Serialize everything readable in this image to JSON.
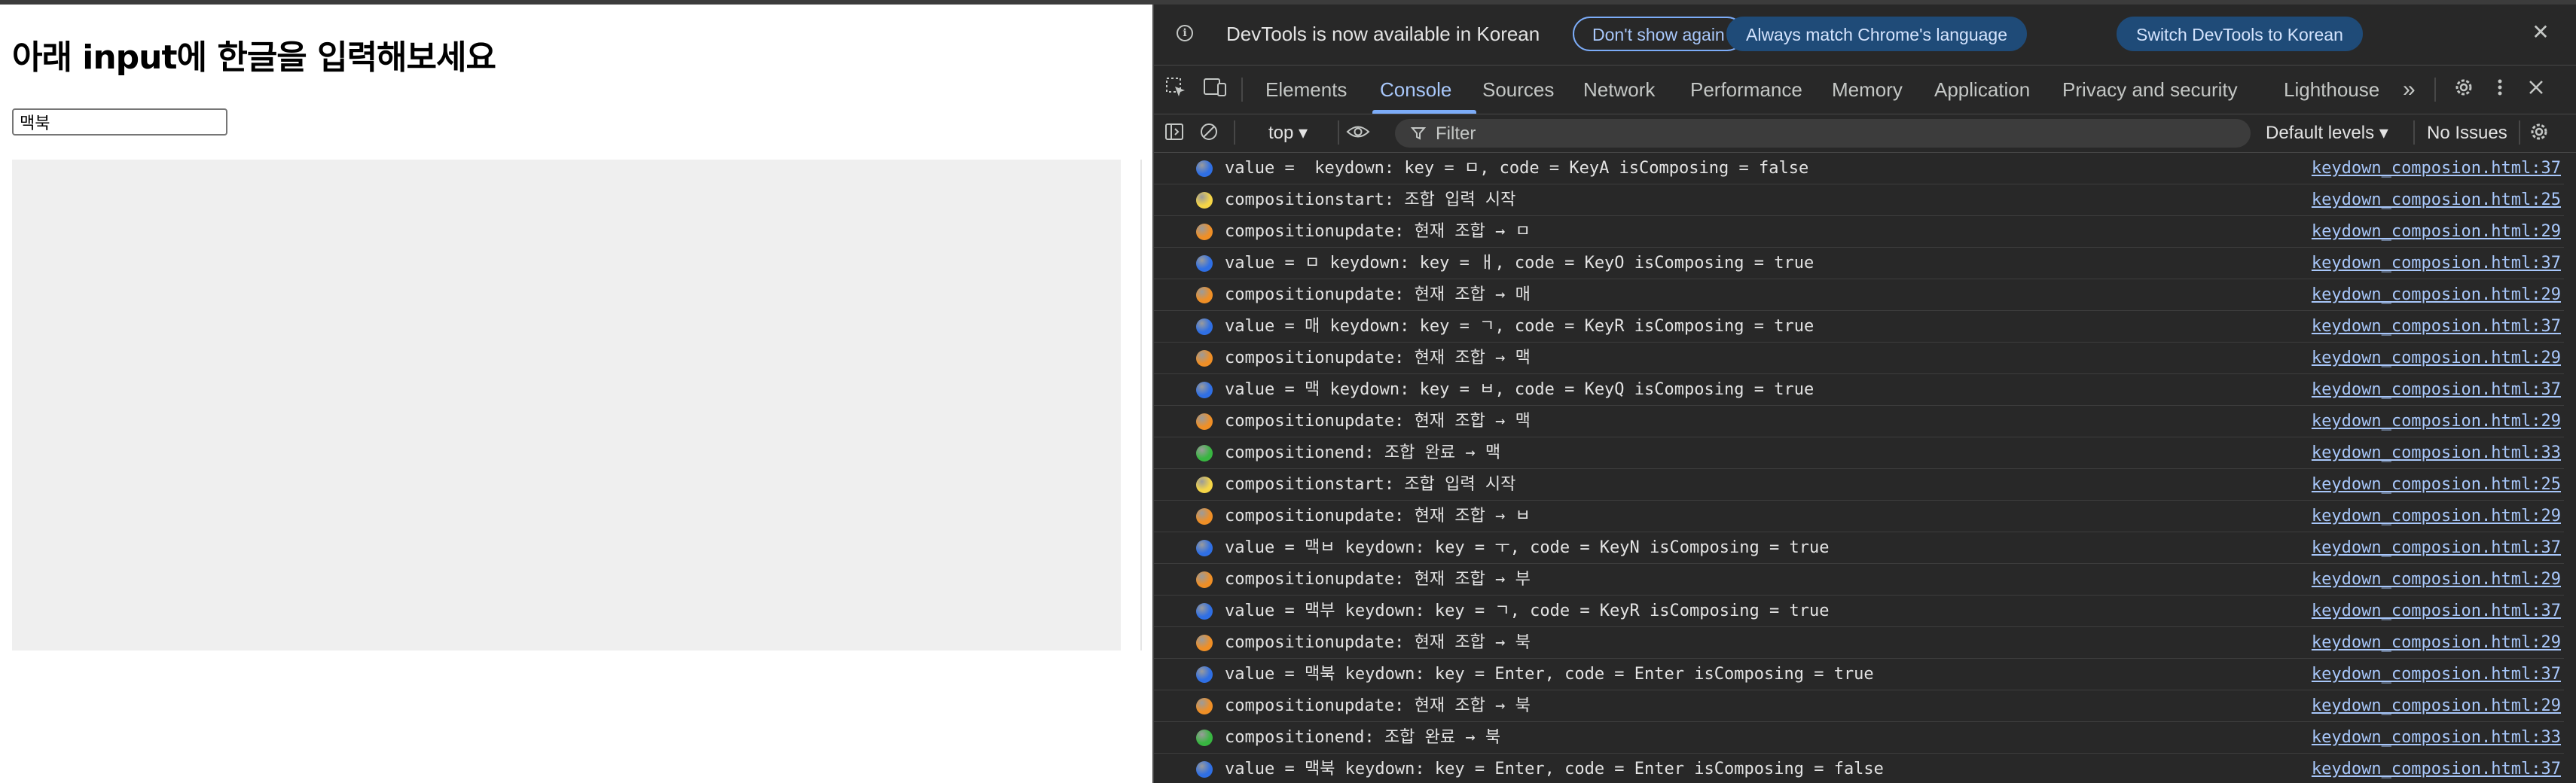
{
  "page": {
    "heading": "아래 input에 한글을 입력해보세요",
    "input_value": "맥북"
  },
  "devtools": {
    "infobar": {
      "message": "DevTools is now available in Korean",
      "dont_show": "Don't show again",
      "always_match": "Always match Chrome's language",
      "switch": "Switch DevTools to Korean",
      "close": "✕"
    },
    "tabs": {
      "elements": "Elements",
      "console": "Console",
      "sources": "Sources",
      "network": "Network",
      "performance": "Performance",
      "memory": "Memory",
      "application": "Application",
      "privacy": "Privacy and security",
      "lighthouse": "Lighthouse",
      "more": "»"
    },
    "toolbar": {
      "context": "top ▾",
      "filter_placeholder": "Filter",
      "levels": "Default levels ▾",
      "issues": "No Issues"
    },
    "colors": {
      "blue": "#2f6fe4",
      "yellow": "#f5d547",
      "orange": "#ef8f26",
      "green": "#38b641"
    },
    "logs": [
      {
        "color": "blue",
        "text": "value =  keydown: key = ㅁ, code = KeyA isComposing = false",
        "src": "keydown_composion.html:37"
      },
      {
        "color": "yellow",
        "text": "compositionstart: 조합 입력 시작",
        "src": "keydown_composion.html:25"
      },
      {
        "color": "orange",
        "text": "compositionupdate: 현재 조합 → ㅁ",
        "src": "keydown_composion.html:29"
      },
      {
        "color": "blue",
        "text": "value = ㅁ keydown: key = ㅐ, code = KeyO isComposing = true",
        "src": "keydown_composion.html:37"
      },
      {
        "color": "orange",
        "text": "compositionupdate: 현재 조합 → 매",
        "src": "keydown_composion.html:29"
      },
      {
        "color": "blue",
        "text": "value = 매 keydown: key = ㄱ, code = KeyR isComposing = true",
        "src": "keydown_composion.html:37"
      },
      {
        "color": "orange",
        "text": "compositionupdate: 현재 조합 → 맥",
        "src": "keydown_composion.html:29"
      },
      {
        "color": "blue",
        "text": "value = 맥 keydown: key = ㅂ, code = KeyQ isComposing = true",
        "src": "keydown_composion.html:37"
      },
      {
        "color": "orange",
        "text": "compositionupdate: 현재 조합 → 맥",
        "src": "keydown_composion.html:29"
      },
      {
        "color": "green",
        "text": "compositionend: 조합 완료 → 맥",
        "src": "keydown_composion.html:33"
      },
      {
        "color": "yellow",
        "text": "compositionstart: 조합 입력 시작",
        "src": "keydown_composion.html:25"
      },
      {
        "color": "orange",
        "text": "compositionupdate: 현재 조합 → ㅂ",
        "src": "keydown_composion.html:29"
      },
      {
        "color": "blue",
        "text": "value = 맥ㅂ keydown: key = ㅜ, code = KeyN isComposing = true",
        "src": "keydown_composion.html:37"
      },
      {
        "color": "orange",
        "text": "compositionupdate: 현재 조합 → 부",
        "src": "keydown_composion.html:29"
      },
      {
        "color": "blue",
        "text": "value = 맥부 keydown: key = ㄱ, code = KeyR isComposing = true",
        "src": "keydown_composion.html:37"
      },
      {
        "color": "orange",
        "text": "compositionupdate: 현재 조합 → 북",
        "src": "keydown_composion.html:29"
      },
      {
        "color": "blue",
        "text": "value = 맥북 keydown: key = Enter, code = Enter isComposing = true",
        "src": "keydown_composion.html:37"
      },
      {
        "color": "orange",
        "text": "compositionupdate: 현재 조합 → 북",
        "src": "keydown_composion.html:29"
      },
      {
        "color": "green",
        "text": "compositionend: 조합 완료 → 북",
        "src": "keydown_composion.html:33"
      },
      {
        "color": "blue",
        "text": "value = 맥북 keydown: key = Enter, code = Enter isComposing = false",
        "src": "keydown_composion.html:37"
      }
    ]
  }
}
